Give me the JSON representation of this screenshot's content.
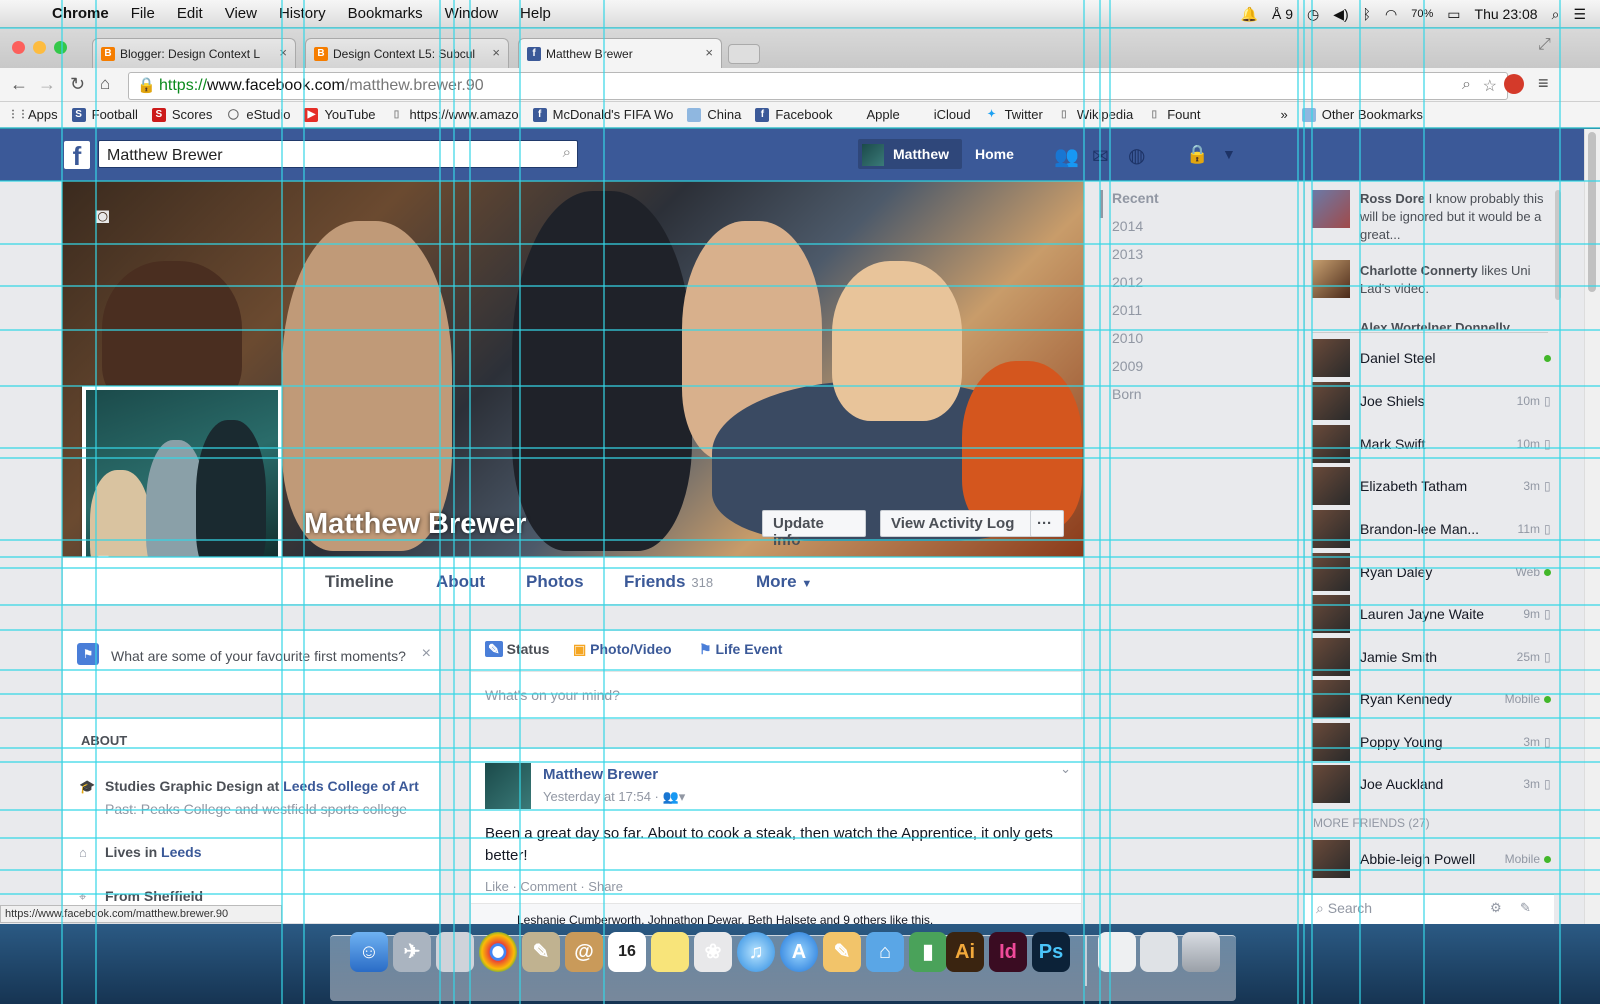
{
  "menubar": {
    "app": "Chrome",
    "items": [
      "File",
      "Edit",
      "View",
      "History",
      "Bookmarks",
      "Window",
      "Help"
    ],
    "status": {
      "notif": "9",
      "battery": "70%",
      "clock": "Thu 23:08"
    }
  },
  "browser": {
    "tabs": [
      {
        "label": "Blogger: Design Context L"
      },
      {
        "label": "Design Context L5: Subcul"
      },
      {
        "label": "Matthew Brewer"
      }
    ],
    "url": {
      "scheme": "https://",
      "host": "www.facebook.com",
      "path": "/matthew.brewer.90"
    },
    "bookmarks": [
      "Apps",
      "Football",
      "Scores",
      "eStudio",
      "YouTube",
      "https://www.amazo",
      "McDonald's FIFA Wo",
      "China",
      "Facebook",
      "Apple",
      "iCloud",
      "Twitter",
      "Wikipedia",
      "Fount"
    ],
    "other_bookmarks": "Other Bookmarks",
    "status_url": "https://www.facebook.com/matthew.brewer.90"
  },
  "fb": {
    "search_value": "Matthew Brewer",
    "nav": {
      "user": "Matthew",
      "home": "Home"
    },
    "profile": {
      "name": "Matthew Brewer",
      "update_info": "Update info",
      "activity_log": "View Activity Log",
      "more_dots": "···"
    },
    "tabs": {
      "timeline": "Timeline",
      "about": "About",
      "photos": "Photos",
      "friends": "Friends",
      "friends_count": "318",
      "more": "More"
    },
    "prompt": "What are some of your favourite first moments?",
    "about": {
      "title": "ABOUT",
      "study": "Studies Graphic Design at",
      "study_place": "Leeds College of Art",
      "past": "Past: Peaks College and westfield sports college",
      "lives": "Lives in",
      "lives_place": "Leeds",
      "from": "From Sheffield"
    },
    "composer": {
      "status": "Status",
      "photo": "Photo/Video",
      "life": "Life Event",
      "placeholder": "What's on your mind?"
    },
    "post": {
      "author": "Matthew Brewer",
      "time": "Yesterday at 17:54 ·",
      "text": "Been a great day so far. About to cook a steak, then watch the Apprentice, it only gets better!",
      "actions": "Like · Comment · Share",
      "likes": "Leshanie Cumberworth, Johnathon Dewar, Beth Halsete and 9 others like this."
    },
    "timeline_nav": [
      "Recent",
      "2014",
      "2013",
      "2012",
      "2011",
      "2010",
      "2009",
      "Born"
    ],
    "ticker": [
      {
        "name": "Ross Dore",
        "text": "I know probably this will be ignored but it would be a great..."
      },
      {
        "name": "Charlotte Connerty",
        "text": "likes Uni Lad's video."
      },
      {
        "name": "Alex Wortelner Donnelly",
        "text": ""
      }
    ],
    "chat": [
      {
        "name": "Daniel Steel",
        "time": "",
        "flag": "dot"
      },
      {
        "name": "Joe Shiels",
        "time": "10m",
        "flag": "phone"
      },
      {
        "name": "Mark Swift",
        "time": "10m",
        "flag": "phone"
      },
      {
        "name": "Elizabeth Tatham",
        "time": "3m",
        "flag": "phone"
      },
      {
        "name": "Brandon-lee Man...",
        "time": "11m",
        "flag": "phone"
      },
      {
        "name": "Ryan Daley",
        "time": "Web",
        "flag": "dot"
      },
      {
        "name": "Lauren Jayne Waite",
        "time": "9m",
        "flag": "phone"
      },
      {
        "name": "Jamie Smith",
        "time": "25m",
        "flag": "phone"
      },
      {
        "name": "Ryan Kennedy",
        "time": "Mobile",
        "flag": "dot"
      },
      {
        "name": "Poppy Young",
        "time": "3m",
        "flag": "phone"
      },
      {
        "name": "Joe Auckland",
        "time": "3m",
        "flag": "phone"
      }
    ],
    "more_friends": "MORE FRIENDS (27)",
    "chat_extra": {
      "name": "Abbie-leigh Powell",
      "time": "Mobile"
    },
    "chat_search": "Search"
  },
  "dock": {
    "items": [
      "Ai",
      "Id",
      "Ps",
      "16"
    ]
  },
  "colors": {
    "fb_blue": "#3b5998",
    "guide": "#35d6e6"
  }
}
